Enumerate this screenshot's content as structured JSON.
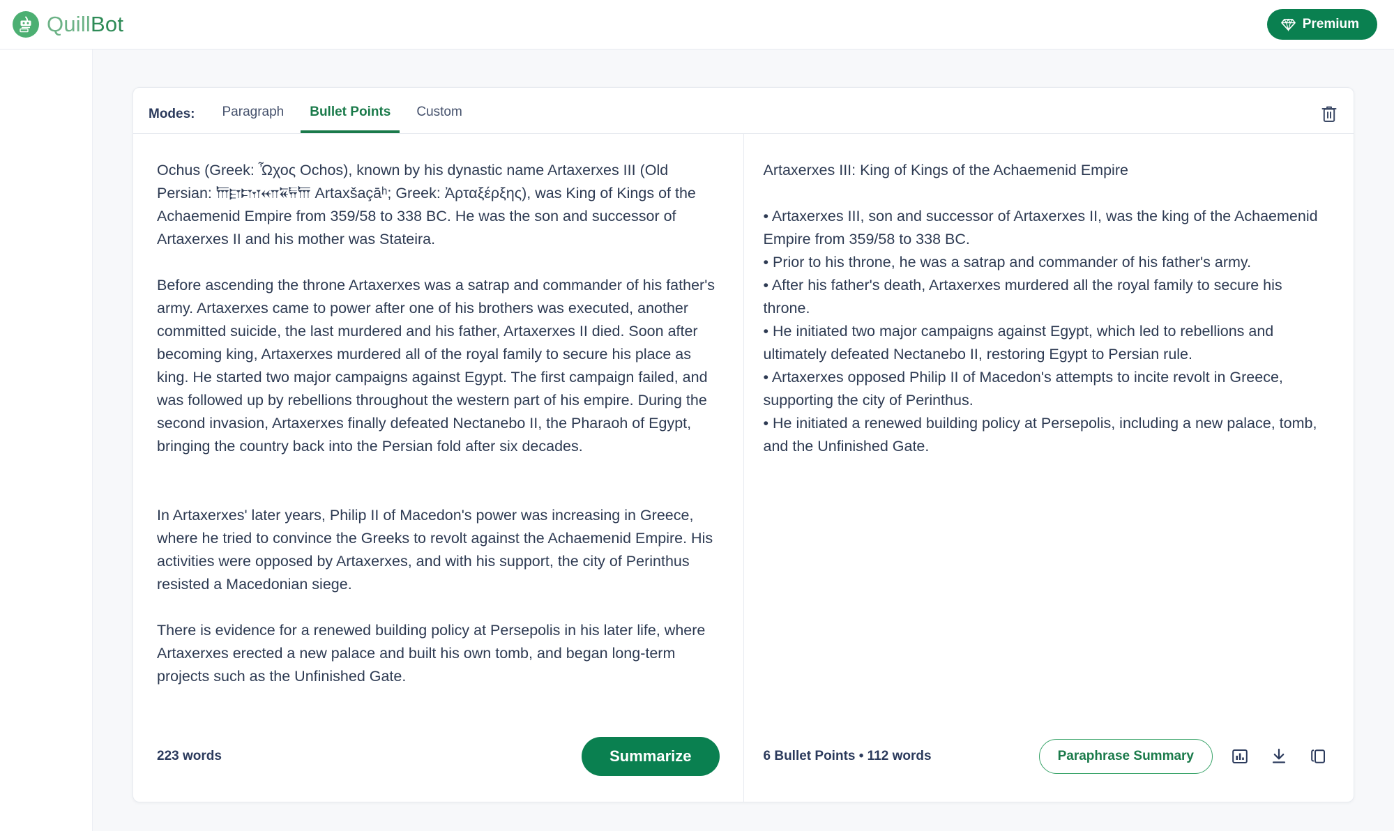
{
  "header": {
    "brand_quill": "Quill",
    "brand_bot": "Bot",
    "premium_label": "Premium",
    "premium_icon": "diamond-icon",
    "logo_icon": "quillbot-robot-icon",
    "premium_color": "#0a8050"
  },
  "modes": {
    "label": "Modes:",
    "tabs": [
      {
        "label": "Paragraph",
        "active": false
      },
      {
        "label": "Bullet Points",
        "active": true
      },
      {
        "label": "Custom",
        "active": false
      }
    ],
    "active_tab": "Bullet Points",
    "active_color": "#1a7a4a",
    "delete_icon": "trash-icon"
  },
  "input_panel": {
    "text": "Ochus (Greek: Ὦχος Ochos), known by his dynastic name Artaxerxes III (Old Persian: 𐎠𐎼𐎫𐎧𐏁𐏂𐎠 Artaxšaçāʰ; Greek: Ἀρταξέρξης), was King of Kings of the Achaemenid Empire from 359/58 to 338 BC. He was the son and successor of Artaxerxes II and his mother was Stateira.\n\nBefore ascending the throne Artaxerxes was a satrap and commander of his father's army. Artaxerxes came to power after one of his brothers was executed, another committed suicide, the last murdered and his father, Artaxerxes II died. Soon after becoming king, Artaxerxes murdered all of the royal family to secure his place as king. He started two major campaigns against Egypt. The first campaign failed, and was followed up by rebellions throughout the western part of his empire. During the second invasion, Artaxerxes finally defeated Nectanebo II, the Pharaoh of Egypt, bringing the country back into the Persian fold after six decades.\n\n\nIn Artaxerxes' later years, Philip II of Macedon's power was increasing in Greece, where he tried to convince the Greeks to revolt against the Achaemenid Empire. His activities were opposed by Artaxerxes, and with his support, the city of Perinthus resisted a Macedonian siege.\n\nThere is evidence for a renewed building policy at Persepolis in his later life, where Artaxerxes erected a new palace and built his own tomb, and began long-term projects such as the Unfinished Gate.",
    "word_count": "223 words",
    "summarize_label": "Summarize"
  },
  "output_panel": {
    "text": "Artaxerxes III: King of Kings of the Achaemenid Empire\n\n• Artaxerxes III, son and successor of Artaxerxes II, was the king of the Achaemenid Empire from 359/58 to 338 BC.\n• Prior to his throne, he was a satrap and commander of his father's army.\n• After his father's death, Artaxerxes murdered all the royal family to secure his throne.\n• He initiated two major campaigns against Egypt, which led to rebellions and ultimately defeated Nectanebo II, restoring Egypt to Persian rule.\n• Artaxerxes opposed Philip II of Macedon's attempts to incite revolt in Greece, supporting the city of Perinthus.\n• He initiated a renewed building policy at Persepolis, including a new palace, tomb, and the Unfinished Gate.",
    "title_line": "Artaxerxes III: King of Kings of the Achaemenid Empire",
    "bullets": [
      "Artaxerxes III, son and successor of Artaxerxes II, was the king of the Achaemenid Empire from 359/58 to 338 BC.",
      "Prior to his throne, he was a satrap and commander of his father's army.",
      "After his father's death, Artaxerxes murdered all the royal family to secure his throne.",
      "He initiated two major campaigns against Egypt, which led to rebellions and ultimately defeated Nectanebo II, restoring Egypt to Persian rule.",
      "Artaxerxes opposed Philip II of Macedon's attempts to incite revolt in Greece, supporting the city of Perinthus.",
      "He initiated a renewed building policy at Persepolis, including a new palace, tomb, and the Unfinished Gate."
    ],
    "stats": "6 Bullet Points • 112 words",
    "paraphrase_label": "Paraphrase Summary",
    "icons": [
      "stats-icon",
      "download-icon",
      "copy-icon"
    ]
  }
}
